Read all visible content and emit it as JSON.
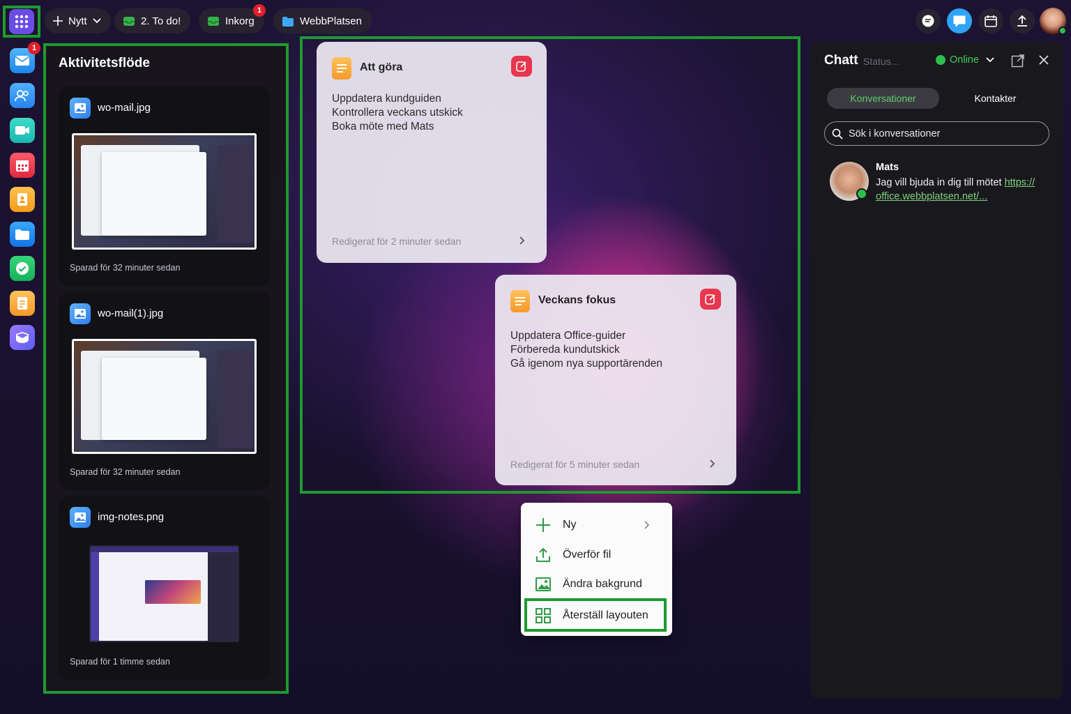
{
  "topbar": {
    "new_label": "Nytt",
    "todo_label": "2. To do!",
    "inbox_label": "Inkorg",
    "inbox_badge": "1",
    "folder_label": "WebbPlatsen"
  },
  "rail": {
    "mail_badge": "1",
    "items": [
      "mail-icon",
      "contacts-icon",
      "meet-icon",
      "calendar-icon",
      "addressbook-icon",
      "drive-icon",
      "tasks-icon",
      "notes-icon",
      "hub-icon"
    ]
  },
  "activity": {
    "title": "Aktivitetsflöde",
    "items": [
      {
        "name": "wo-mail.jpg",
        "saved": "Sparad för 32 minuter sedan"
      },
      {
        "name": "wo-mail(1).jpg",
        "saved": "Sparad för 32 minuter sedan"
      },
      {
        "name": "img-notes.png",
        "saved": "Sparad för 1 timme sedan"
      }
    ]
  },
  "notes": [
    {
      "title": "Att göra",
      "lines": [
        "Uppdatera kundguiden",
        "Kontrollera veckans utskick",
        "Boka möte med Mats"
      ],
      "edited": "Redigerat för 2 minuter sedan"
    },
    {
      "title": "Veckans fokus",
      "lines": [
        "Uppdatera Office-guider",
        "Förbereda kundutskick",
        "Gå igenom nya supportärenden"
      ],
      "edited": "Redigerat för 5 minuter sedan"
    }
  ],
  "context_menu": {
    "new": "Ny",
    "upload": "Överför fil",
    "background": "Ändra bakgrund",
    "reset": "Återställ layouten"
  },
  "chat": {
    "title": "Chatt",
    "status_placeholder": "Status...",
    "presence": "Online",
    "tab_conversations": "Konversationer",
    "tab_contacts": "Kontakter",
    "search_placeholder": "Sök i konversationer",
    "conversation": {
      "name": "Mats",
      "message": "Jag vill bjuda in dig till mötet ",
      "link_line1": "https://",
      "link_line2": "office.webbplatsen.net/..."
    }
  },
  "colors": {
    "highlight": "#1e9a2e",
    "accent_purple": "#6b4de6",
    "online_green": "#2dbf4a",
    "edit_red": "#e8364e"
  }
}
